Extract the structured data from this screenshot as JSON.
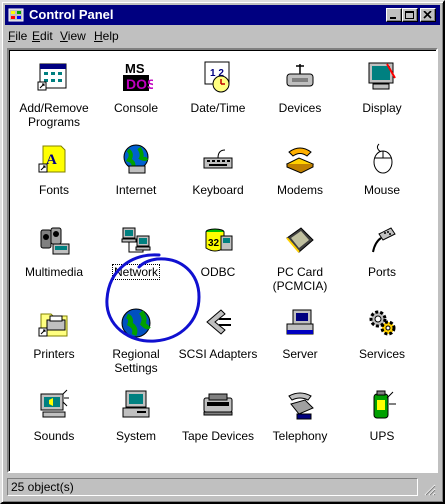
{
  "window": {
    "title": "Control Panel",
    "controls": {
      "minimize": "minimize",
      "maximize": "maximize",
      "close": "close"
    }
  },
  "menu": [
    {
      "label": "File",
      "accel": "F",
      "rest": "ile"
    },
    {
      "label": "Edit",
      "accel": "E",
      "rest": "dit"
    },
    {
      "label": "View",
      "accel": "V",
      "rest": "iew"
    },
    {
      "label": "Help",
      "accel": "H",
      "rest": "elp"
    }
  ],
  "items": [
    {
      "label": "Add/Remove",
      "label2": "Programs",
      "icon": "add-remove-programs-icon"
    },
    {
      "label": "Console",
      "icon": "console-icon"
    },
    {
      "label": "Date/Time",
      "icon": "date-time-icon"
    },
    {
      "label": "Devices",
      "icon": "devices-icon"
    },
    {
      "label": "Display",
      "icon": "display-icon"
    },
    {
      "label": "Fonts",
      "icon": "fonts-icon"
    },
    {
      "label": "Internet",
      "icon": "internet-icon"
    },
    {
      "label": "Keyboard",
      "icon": "keyboard-icon"
    },
    {
      "label": "Modems",
      "icon": "modems-icon"
    },
    {
      "label": "Mouse",
      "icon": "mouse-icon"
    },
    {
      "label": "Multimedia",
      "icon": "multimedia-icon"
    },
    {
      "label": "Network",
      "icon": "network-icon",
      "focused": true
    },
    {
      "label": "ODBC",
      "icon": "odbc-icon"
    },
    {
      "label": "PC Card",
      "label2": "(PCMCIA)",
      "icon": "pc-card-icon"
    },
    {
      "label": "Ports",
      "icon": "ports-icon"
    },
    {
      "label": "Printers",
      "icon": "printers-icon"
    },
    {
      "label": "Regional",
      "label2": "Settings",
      "icon": "regional-settings-icon"
    },
    {
      "label": "SCSI Adapters",
      "icon": "scsi-adapters-icon"
    },
    {
      "label": "Server",
      "icon": "server-icon"
    },
    {
      "label": "Services",
      "icon": "services-icon"
    },
    {
      "label": "Sounds",
      "icon": "sounds-icon"
    },
    {
      "label": "System",
      "icon": "system-icon"
    },
    {
      "label": "Tape Devices",
      "icon": "tape-devices-icon"
    },
    {
      "label": "Telephony",
      "icon": "telephony-icon"
    },
    {
      "label": "UPS",
      "icon": "ups-icon"
    }
  ],
  "status": {
    "text": "25 object(s)"
  },
  "colors": {
    "titlebar": "#000080",
    "face": "#c0c0c0",
    "annotation": "#1010d0"
  }
}
